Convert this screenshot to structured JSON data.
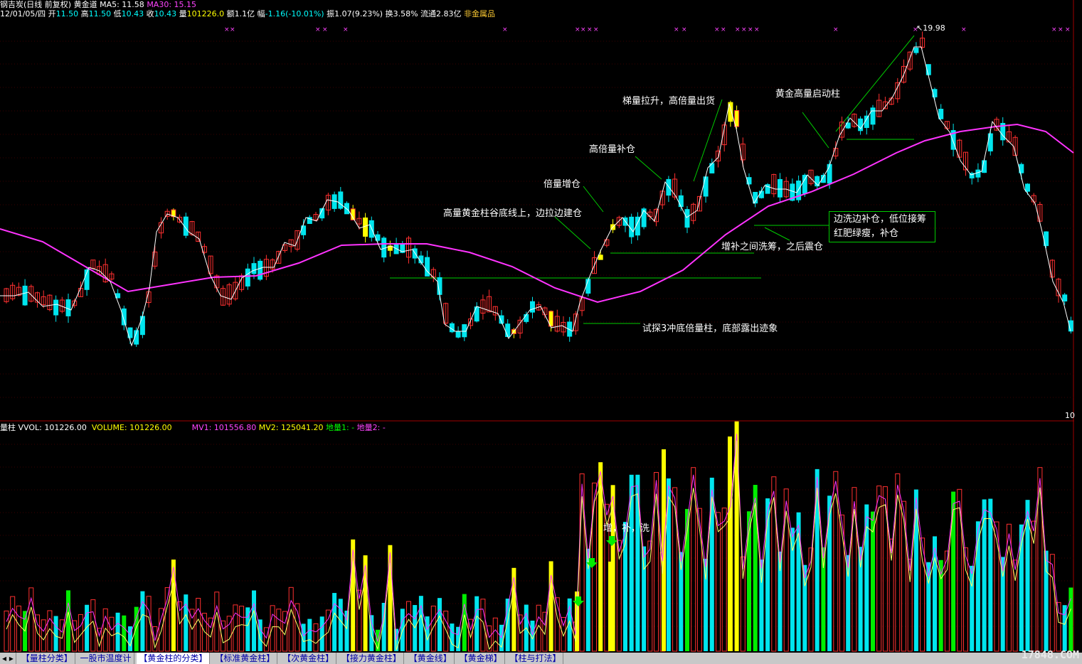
{
  "info": {
    "stock_name": "钢吉炭(日线 前复权)",
    "indicator_name": "黄金道",
    "ma5_label": "MA5: 11.58",
    "ma30_label": "MA30: 15.15",
    "date": "12/01/05/四",
    "open_label": "开",
    "open": "11.50",
    "high_label": "高",
    "high": "11.50",
    "low_label": "低",
    "low": "10.43",
    "close_label": "收",
    "close": "10.43",
    "vol_label": "量",
    "vol": "101226.0",
    "amount": "额1.1亿",
    "change_label": "幅",
    "change": "-1.16(-10.01%)",
    "amplitude": "振1.07(9.23%)",
    "turnover": "换3.58%",
    "float": "流通2.83亿",
    "sector": "非金属品"
  },
  "price_panel": {
    "high_marker": "19.98",
    "right_tick": "10"
  },
  "annotations": {
    "a1": "梯量拉升，高倍量出货",
    "a2": "黄金高量启动柱",
    "a3": "高倍量补仓",
    "a4": "倍量增仓",
    "a5": "高量黄金柱谷底线上，边拉边建仓",
    "a6": "边洗边补仓，低位接筹",
    "a7": "红肥绿瘦，补仓",
    "a8": "增补之间洗筹，之后震仓",
    "a9": "试探3冲底倍量柱，底部露出迹象",
    "a10": "增，补，洗"
  },
  "volume_panel": {
    "title": "量柱",
    "vvol": "VVOL: 101226.00",
    "volume": "VOLUME: 101226.00",
    "mv1": "MV1: 101556.80",
    "mv2": "MV2: 125041.20",
    "dl1": "地量1: -",
    "dl2": "地量2: -"
  },
  "tabs": [
    {
      "label": "【量柱分类】"
    },
    {
      "label": "一股市温度计"
    },
    {
      "label": "【黄金柱的分类】"
    },
    {
      "label": "【标准黄金柱】"
    },
    {
      "label": "【次黄金柱】"
    },
    {
      "label": "【接力黄金柱】"
    },
    {
      "label": "【黄金线】"
    },
    {
      "label": "【黄金梯】"
    },
    {
      "label": "【柱与打法】"
    }
  ],
  "watermark": "17848.COM",
  "colors": {
    "up": "#ff3030",
    "down": "#00e5ee",
    "gold": "#ffff00",
    "ma5": "#ffffff",
    "ma30": "#ff33ff",
    "guide": "#00cc00"
  },
  "chart_data": {
    "type": "candlestick",
    "note_values": "closing prices approximated from the screenshot; y scale not labeled except 19.98 high and 10 tick",
    "high_point": 19.98,
    "last_close": 10.43
  }
}
